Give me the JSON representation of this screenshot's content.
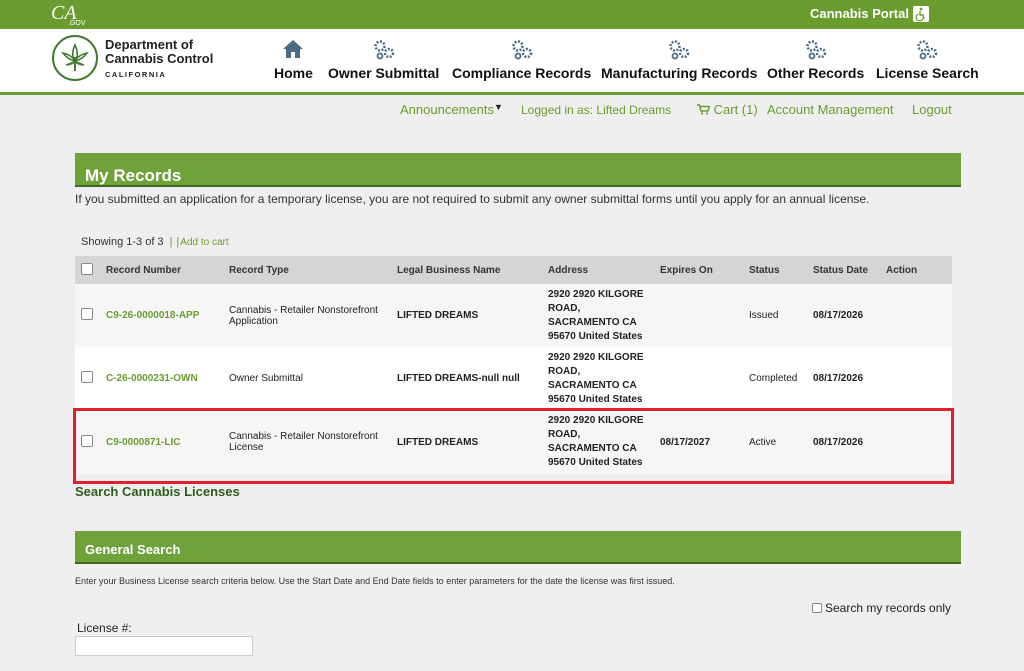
{
  "topbar": {
    "portal_label": "Cannabis Portal",
    "cagov_text": "CA.gov"
  },
  "header": {
    "dept_line1": "Department of",
    "dept_line2": "Cannabis Control",
    "dept_line3": "CALIFORNIA",
    "nav": [
      {
        "label": "Home",
        "icon": "home-icon"
      },
      {
        "label": "Owner Submittal",
        "icon": "gears-icon"
      },
      {
        "label": "Compliance Records",
        "icon": "gears-icon"
      },
      {
        "label": "Manufacturing Records",
        "icon": "gears-icon"
      },
      {
        "label": "Other Records",
        "icon": "gears-icon"
      },
      {
        "label": "License Search",
        "icon": "gears-icon"
      }
    ]
  },
  "subnav": {
    "announcements": "Announcements",
    "logged_in": "Logged in as: Lifted Dreams",
    "cart": "Cart (1)",
    "account": "Account Management",
    "logout": "Logout"
  },
  "records": {
    "title": "My Records",
    "notice": "If you submitted an application for a temporary license, you are not required to submit any owner submittal forms until you apply for an annual license.",
    "showing": "Showing 1-3 of 3",
    "add_to_cart": "Add to cart",
    "columns": [
      "Record Number",
      "Record Type",
      "Legal Business Name",
      "Address",
      "Expires On",
      "Status",
      "Status Date",
      "Action"
    ],
    "rows": [
      {
        "record_number": "C9-26-0000018-APP",
        "record_type": "Cannabis - Retailer Nonstorefront Application",
        "business_name": "LIFTED DREAMS",
        "address": "2920 2920 KILGORE ROAD, SACRAMENTO CA 95670 United States",
        "expires_on": "",
        "status": "Issued",
        "status_date": "08/17/2026",
        "action": ""
      },
      {
        "record_number": "C-26-0000231-OWN",
        "record_type": "Owner Submittal",
        "business_name": "LIFTED DREAMS-null null",
        "address": "2920 2920 KILGORE ROAD, SACRAMENTO CA 95670 United States",
        "expires_on": "",
        "status": "Completed",
        "status_date": "08/17/2026",
        "action": ""
      },
      {
        "record_number": "C9-0000871-LIC",
        "record_type": "Cannabis - Retailer Nonstorefront License",
        "business_name": "LIFTED DREAMS",
        "address": "2920 2920 KILGORE ROAD, SACRAMENTO CA 95670 United States",
        "expires_on": "08/17/2027",
        "status": "Active",
        "status_date": "08/17/2026",
        "action": ""
      }
    ],
    "search_link": "Search Cannabis Licenses"
  },
  "general_search": {
    "title": "General Search",
    "description": "Enter your Business License search criteria below.  Use the Start Date and End Date fields to enter parameters for the date the license was first issued.",
    "search_mine_label": "Search my records only",
    "license_label": "License #:",
    "license_value": ""
  },
  "colors": {
    "brand_green": "#6a9c2f",
    "highlight_red": "#e0202a"
  }
}
